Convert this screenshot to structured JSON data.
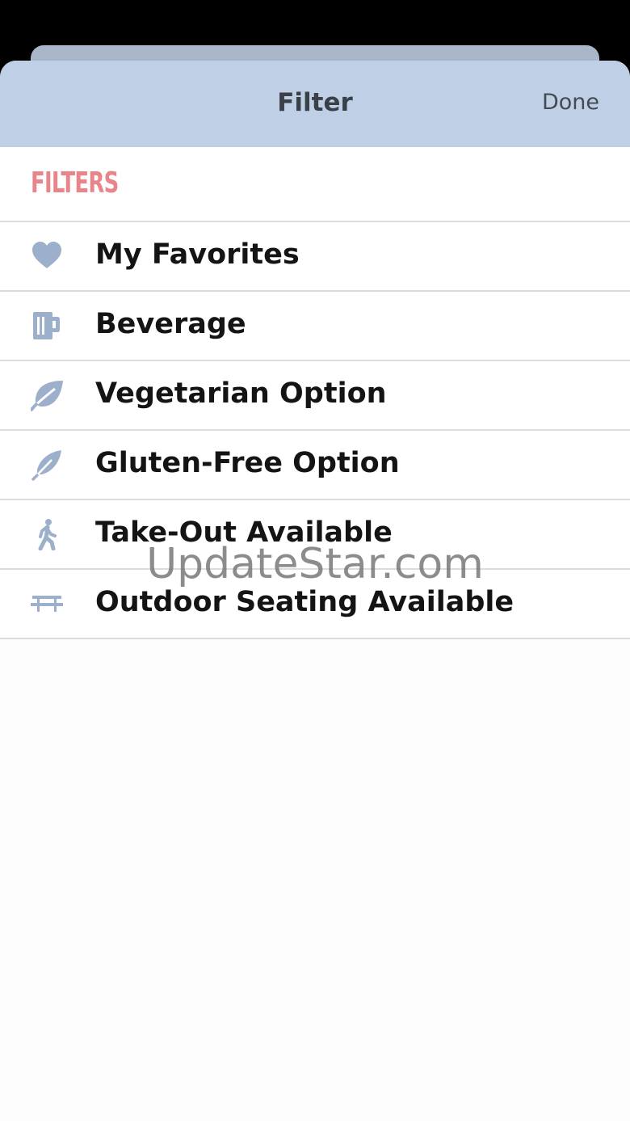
{
  "header": {
    "title": "Filter",
    "done_label": "Done"
  },
  "section": {
    "title": "FILTERS"
  },
  "filters": [
    {
      "label": "My Favorites",
      "icon": "heart-icon"
    },
    {
      "label": "Beverage",
      "icon": "beer-mug-icon"
    },
    {
      "label": "Vegetarian Option",
      "icon": "leaf-icon"
    },
    {
      "label": "Gluten-Free Option",
      "icon": "feather-icon"
    },
    {
      "label": "Take-Out Available",
      "icon": "walking-person-icon"
    },
    {
      "label": "Outdoor Seating Available",
      "icon": "picnic-table-icon"
    }
  ],
  "watermark": "UpdateStar.com",
  "colors": {
    "header_bg": "#bfd0e6",
    "section_title": "#e8858b",
    "icon": "#9db0cb"
  }
}
